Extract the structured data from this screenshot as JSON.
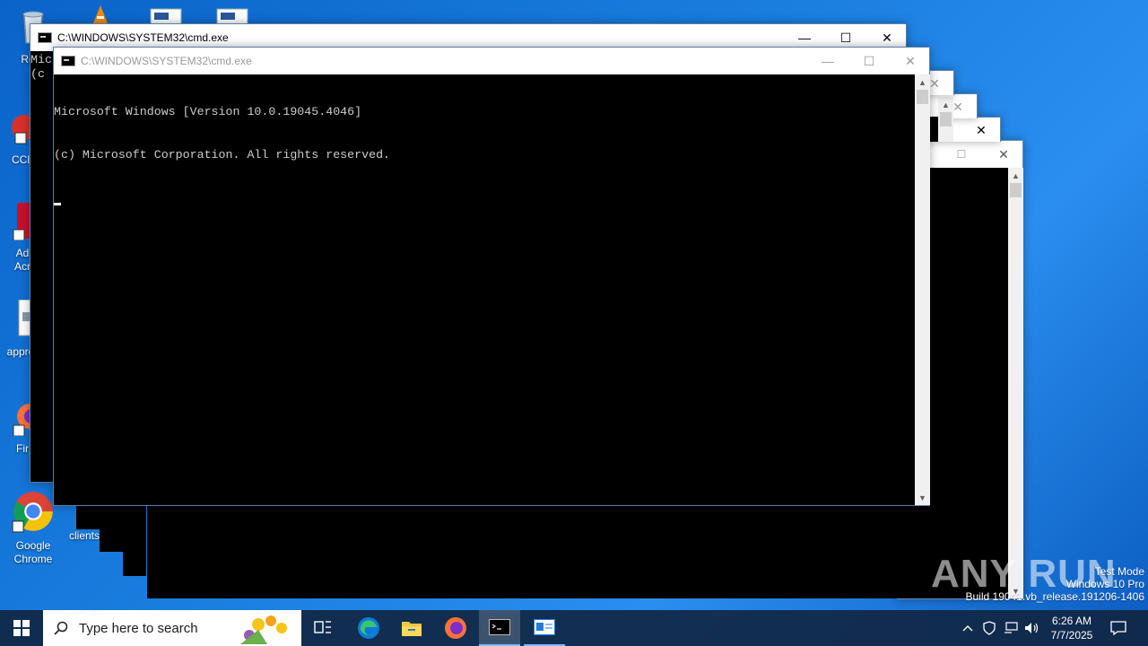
{
  "desktop": {
    "icons": [
      {
        "label": "Recy",
        "name": "recycle-bin"
      },
      {
        "label": "CCl",
        "name": "ccleaner"
      },
      {
        "label": "Ad\nAcr",
        "name": "adobe-acrobat"
      },
      {
        "label": "appro",
        "name": "document-file"
      },
      {
        "label": "Fir",
        "name": "firefox"
      },
      {
        "label": "Google\nChrome",
        "name": "google-chrome"
      },
      {
        "label": "clients",
        "name": "clients-file"
      }
    ]
  },
  "back_window": {
    "title": "C:\\WINDOWS\\SYSTEM32\\cmd.exe",
    "console_peek": "Mic\n(c"
  },
  "front_window": {
    "title": "C:\\WINDOWS\\SYSTEM32\\cmd.exe",
    "console_lines": [
      "Microsoft Windows [Version 10.0.19045.4046]",
      "(c) Microsoft Corporation. All rights reserved."
    ]
  },
  "taskbar": {
    "search_placeholder": "Type here to search",
    "time": "6:26 AM",
    "date": "7/7/2025"
  },
  "watermark": {
    "line1": "Test Mode",
    "line2": "Windows 10 Pro",
    "line3": "Build 19041.vb_release.191206-1406",
    "logo_text": "ANY RUN"
  },
  "colors": {
    "console_bg": "#000000",
    "console_fg": "#cccccc",
    "taskbar_bg": "#102642"
  }
}
